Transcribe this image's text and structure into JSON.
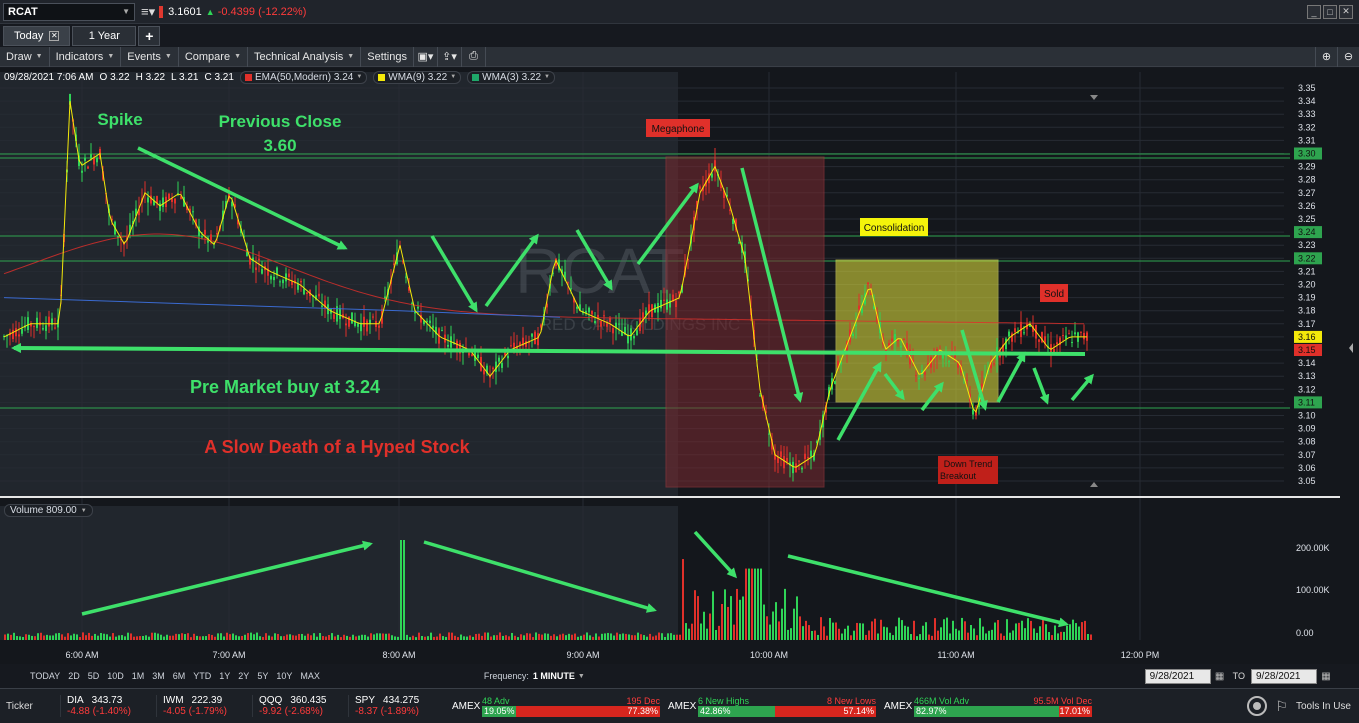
{
  "titlebar": {
    "symbol": "RCAT",
    "last_price": "3.1601",
    "change": "-0.4399 (-12.22%)"
  },
  "tabs": [
    {
      "label": "Today"
    },
    {
      "label": "1 Year"
    }
  ],
  "toolbar": {
    "items": [
      "Draw",
      "Indicators",
      "Events",
      "Compare",
      "Technical Analysis",
      "Settings"
    ]
  },
  "legend": {
    "datetime": "09/28/2021 7:06 AM",
    "o": "O 3.22",
    "h": "H 3.22",
    "l": "L 3.21",
    "c": "C 3.21",
    "indicators": [
      {
        "label": "EMA(50,Modern) 3.24",
        "color": "#e0302a"
      },
      {
        "label": "WMA(9) 3.22",
        "color": "#f4e90a"
      },
      {
        "label": "WMA(3) 3.22",
        "color": "#1fa86a"
      }
    ]
  },
  "watermark": {
    "symbol": "RCAT",
    "company": "RED CAT HOLDINGS INC"
  },
  "annotations": {
    "spike": "Spike",
    "previous_close_1": "Previous Close",
    "previous_close_2": "3.60",
    "premarket": "Pre Market buy at 3.24",
    "slow_death": "A Slow Death of a Hyped Stock",
    "megaphone": "Megaphone",
    "consolidation": "Consolidation",
    "sold": "Sold",
    "down_trend_1": "Down Trend",
    "down_trend_2": "Breakout"
  },
  "price_axis": {
    "ticks": [
      "3.35",
      "3.34",
      "3.33",
      "3.32",
      "3.31",
      "3.30",
      "3.29",
      "3.28",
      "3.27",
      "3.26",
      "3.25",
      "3.24",
      "3.23",
      "3.22",
      "3.21",
      "3.20",
      "3.19",
      "3.18",
      "3.17",
      "3.16",
      "3.15",
      "3.14",
      "3.13",
      "3.12",
      "3.11",
      "3.10",
      "3.09",
      "3.08",
      "3.07",
      "3.06",
      "3.05"
    ],
    "badges": [
      {
        "label": "3.30",
        "color": "#2ea44f"
      },
      {
        "label": "3.24",
        "color": "#2ea44f"
      },
      {
        "label": "3.22",
        "color": "#2ea44f"
      },
      {
        "label": "3.16",
        "color": "#f4e90a"
      },
      {
        "label": "3.15",
        "color": "#e0302a"
      },
      {
        "label": "3.11",
        "color": "#2ea44f"
      }
    ]
  },
  "volume": {
    "chip": "Volume 809.00",
    "ticks": [
      "200.00K",
      "100.00K",
      "0.00"
    ]
  },
  "time_axis": {
    "ticks": [
      "6:00 AM",
      "7:00 AM",
      "8:00 AM",
      "9:00 AM",
      "10:00 AM",
      "11:00 AM",
      "12:00 PM"
    ]
  },
  "timebar": {
    "ranges": [
      "TODAY",
      "2D",
      "5D",
      "10D",
      "1M",
      "3M",
      "6M",
      "YTD",
      "1Y",
      "2Y",
      "5Y",
      "10Y",
      "MAX"
    ],
    "frequency_label": "Frequency:",
    "frequency_value": "1 MINUTE",
    "from_date": "9/28/2021",
    "to_label": "TO",
    "to_date": "9/28/2021"
  },
  "statusbar": {
    "ticker_label": "Ticker",
    "tickers": [
      {
        "sym": "DIA",
        "price": "343.73",
        "chg": "-4.88 (-1.40%)"
      },
      {
        "sym": "IWM",
        "price": "222.39",
        "chg": "-4.05 (-1.79%)"
      },
      {
        "sym": "QQQ",
        "price": "360.435",
        "chg": "-9.92 (-2.68%)"
      },
      {
        "sym": "SPY",
        "price": "434.275",
        "chg": "-8.37 (-1.89%)"
      }
    ],
    "breadth": [
      {
        "exchange": "AMEX",
        "left": "48 Adv",
        "right": "195 Dec",
        "left_pct": "19.05%",
        "right_pct": "77.38%",
        "fill": 0.19
      },
      {
        "exchange": "AMEX",
        "left": "6 New Highs",
        "right": "8 New Lows",
        "left_pct": "42.86%",
        "right_pct": "57.14%",
        "fill": 0.43
      },
      {
        "exchange": "AMEX",
        "left": "466M Vol Adv",
        "right": "95.5M Vol Dec",
        "left_pct": "82.97%",
        "right_pct": "17.01%",
        "fill": 0.83
      }
    ],
    "tools_label": "Tools In Use"
  }
}
